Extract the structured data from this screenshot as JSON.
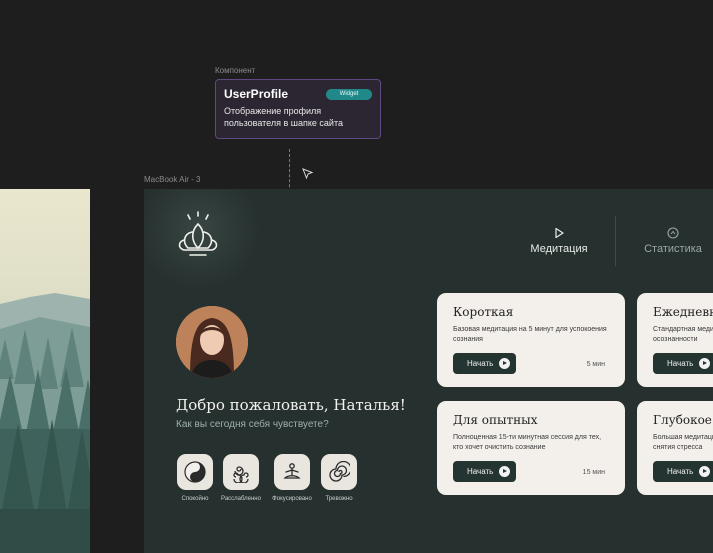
{
  "canvas": {
    "component_label": "Компонент",
    "frame_label": "MacBook Air - 3"
  },
  "component": {
    "name": "UserProfile",
    "badge": "Widget",
    "description": "Отображение профиля пользователя в шапке сайта"
  },
  "nav": {
    "meditation": "Медитация",
    "stats": "Статистика"
  },
  "user": {
    "greeting": "Добро пожаловать, Наталья!",
    "question": "Как вы сегодня себя чувствуете?"
  },
  "moods": [
    {
      "label": "Спокойно",
      "icon": "yin-yang-icon"
    },
    {
      "label": "Расслабленно",
      "icon": "spirals-icon"
    },
    {
      "label": "Фокусировано",
      "icon": "meditating-person-icon"
    },
    {
      "label": "Тревожно",
      "icon": "spiral-icon"
    }
  ],
  "cards": [
    {
      "title": "Короткая",
      "desc": "Базовая медитация на 5 минут для успокоения сознания",
      "button": "Начать",
      "duration": "5 мин"
    },
    {
      "title": "Ежедневн",
      "desc": "Стандартная меди осознанности",
      "button": "Начать",
      "duration": ""
    },
    {
      "title": "Для опытных",
      "desc": "Полноценная 15-ти минутная сессия для тех, кто хочет очистить сознание",
      "button": "Начать",
      "duration": "15 мин"
    },
    {
      "title": "Глубокое",
      "desc": "Большая медитаци снятия стресса",
      "button": "Начать",
      "duration": ""
    }
  ],
  "colors": {
    "frame_bg": "#26302e",
    "card_bg": "#f3f0eb",
    "button_bg": "#243431",
    "badge": "#21888a",
    "component_border": "#5d4a83"
  }
}
